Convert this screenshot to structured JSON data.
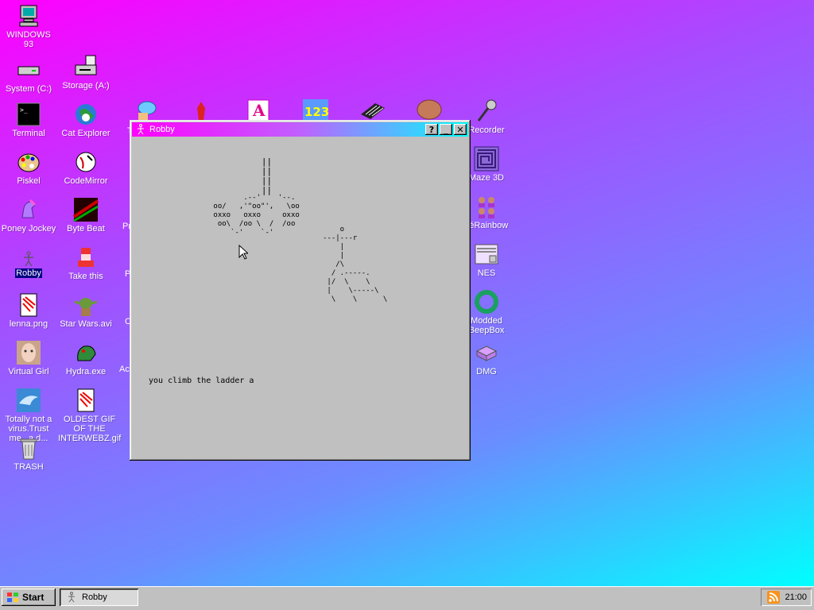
{
  "desktop": {
    "icons": [
      {
        "id": "windows93",
        "label": "WINDOWS 93",
        "icon": "computer-icon"
      },
      {
        "id": "system-c",
        "label": "System (C:)",
        "icon": "drive-icon"
      },
      {
        "id": "storage-a",
        "label": "Storage (A:)",
        "icon": "floppy-drive-icon"
      },
      {
        "id": "terminal",
        "label": "Terminal",
        "icon": "terminal-icon"
      },
      {
        "id": "cat-explorer",
        "label": "Cat Explorer",
        "icon": "globe-cat-icon"
      },
      {
        "id": "piskel",
        "label": "Piskel",
        "icon": "palette-icon"
      },
      {
        "id": "codemirror",
        "label": "CodeMirror",
        "icon": "codemirror-icon"
      },
      {
        "id": "poney-jockey",
        "label": "Poney Jockey",
        "icon": "pony-icon"
      },
      {
        "id": "byte-beat",
        "label": "Byte Beat",
        "icon": "bytebeat-icon"
      },
      {
        "id": "robby",
        "label": "Robby",
        "icon": "robot-icon"
      },
      {
        "id": "take-this",
        "label": "Take this",
        "icon": "pixel-character-icon"
      },
      {
        "id": "lenna",
        "label": "lenna.png",
        "icon": "image-file-icon"
      },
      {
        "id": "star-wars",
        "label": "Star Wars.avi",
        "icon": "yoda-icon"
      },
      {
        "id": "virtual-girl",
        "label": "Virtual Girl",
        "icon": "face-icon"
      },
      {
        "id": "hydra",
        "label": "Hydra.exe",
        "icon": "hydra-icon"
      },
      {
        "id": "virus",
        "label": "Totally not a virus.Trust me...a d...",
        "icon": "dolphin-icon"
      },
      {
        "id": "oldest-gif",
        "label": "OLDEST GIF OF THE INTERWEBZ.gif",
        "icon": "gif-file-icon"
      },
      {
        "id": "trash",
        "label": "TRASH",
        "icon": "trash-icon"
      },
      {
        "id": "recorder",
        "label": "Recorder",
        "icon": "microphone-icon"
      },
      {
        "id": "maze3d",
        "label": "Maze 3D",
        "icon": "maze-icon"
      },
      {
        "id": "fakerainbow",
        "label": "kéRainbow",
        "icon": "people-icon"
      },
      {
        "id": "nes",
        "label": "NES",
        "icon": "nes-icon"
      },
      {
        "id": "beepbox",
        "label": "Modded BeepBox",
        "icon": "ring-icon"
      },
      {
        "id": "dmg",
        "label": "DMG",
        "icon": "dmg-icon"
      }
    ],
    "partial_labels": {
      "p1": "Pr",
      "p2": "P",
      "p3": "C",
      "p4": "Ac",
      "p5": "T"
    }
  },
  "window": {
    "title": "Robby",
    "help_label": "?",
    "minimize_label": "_",
    "close_label": "✕",
    "game_text": "you climb the ladder a",
    "ascii_ladder": "   ||\n   ||\n   ||\n   ||",
    "ascii_bombs": "        .--'    '--.\n oo/   ,'\"oo\"',   \\oo\n oxxo   oxxo     oxxo\n  oo\\  /oo \\  /  /oo\n     `-'    `-'",
    "ascii_robot": "    o\n---|---r\n    |\n    |\n   /\\\n  / .-----.\n |/  \\    \\\n |    \\-----\\\n  \\    \\      \\"
  },
  "taskbar": {
    "start_label": "Start",
    "task_label": "Robby",
    "clock": "21:00"
  }
}
